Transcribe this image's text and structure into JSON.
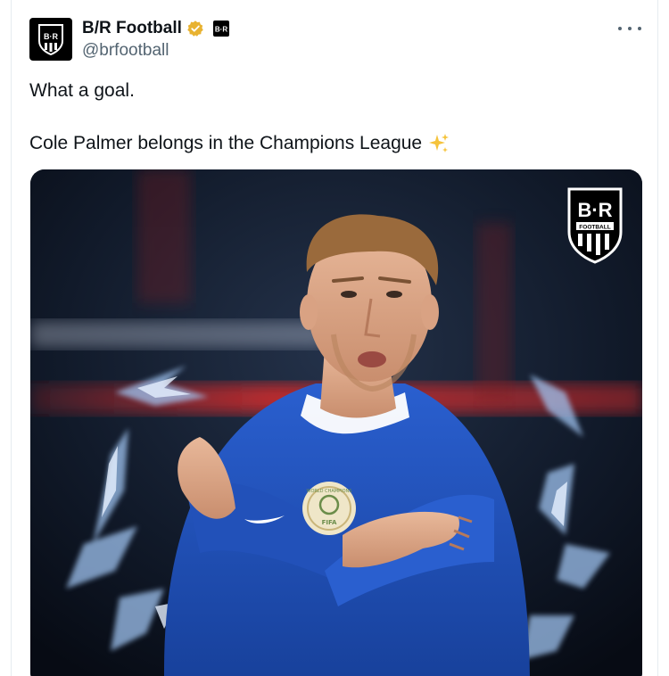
{
  "author": {
    "display_name": "B/R Football",
    "handle": "@brfootball",
    "avatar_logo": "B·R",
    "verified": true,
    "affiliate_badge": "B·R"
  },
  "post": {
    "line1": "What a goal.",
    "line2": "Cole Palmer belongs in the Champions League",
    "emoji": "sparkles-icon"
  },
  "media": {
    "logo_text": "B·R",
    "logo_subtext": "FOOTBALL",
    "badge_text_top": "WORLD CHAMPIONS",
    "badge_text_bottom": "FIFA"
  },
  "colors": {
    "verified": "#e8b230",
    "jersey": "#1f4fb8",
    "background_red": "#d32a2a"
  }
}
